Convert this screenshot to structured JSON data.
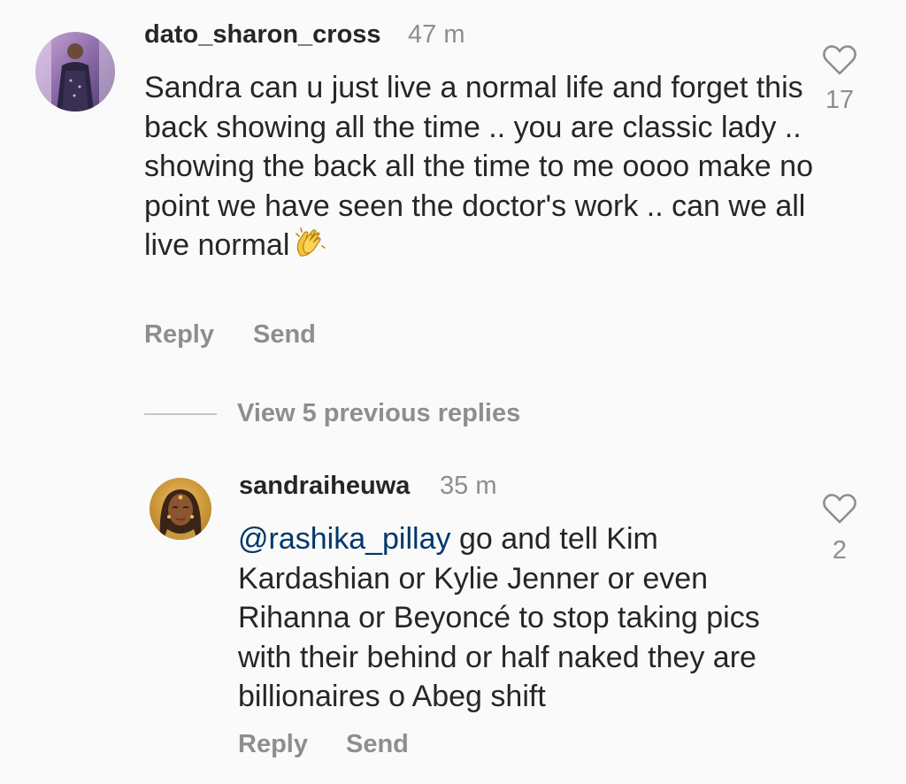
{
  "comment": {
    "username": "dato_sharon_cross",
    "time": "47 m",
    "text": "Sandra can u just live a normal life and forget this back showing all the time .. you are classic lady .. showing the back all the time to me oooo make no point we have seen the doctor's work .. can we all live normal",
    "emoji_icon": "clapping-hands",
    "likes": "17",
    "reply_label": "Reply",
    "send_label": "Send"
  },
  "view_replies_label": "View 5 previous replies",
  "reply": {
    "username": "sandraiheuwa",
    "time": "35 m",
    "mention": "@rashika_pillay",
    "text": " go and tell Kim Kardashian or Kylie Jenner or even Rihanna or Beyoncé to stop taking pics with their behind or half naked they are billionaires o Abeg shift",
    "likes": "2",
    "reply_label": "Reply",
    "send_label": "Send"
  },
  "colors": {
    "background": "#fafafa",
    "text": "#262626",
    "secondary": "#8e8e8e",
    "mention": "#00376b"
  }
}
